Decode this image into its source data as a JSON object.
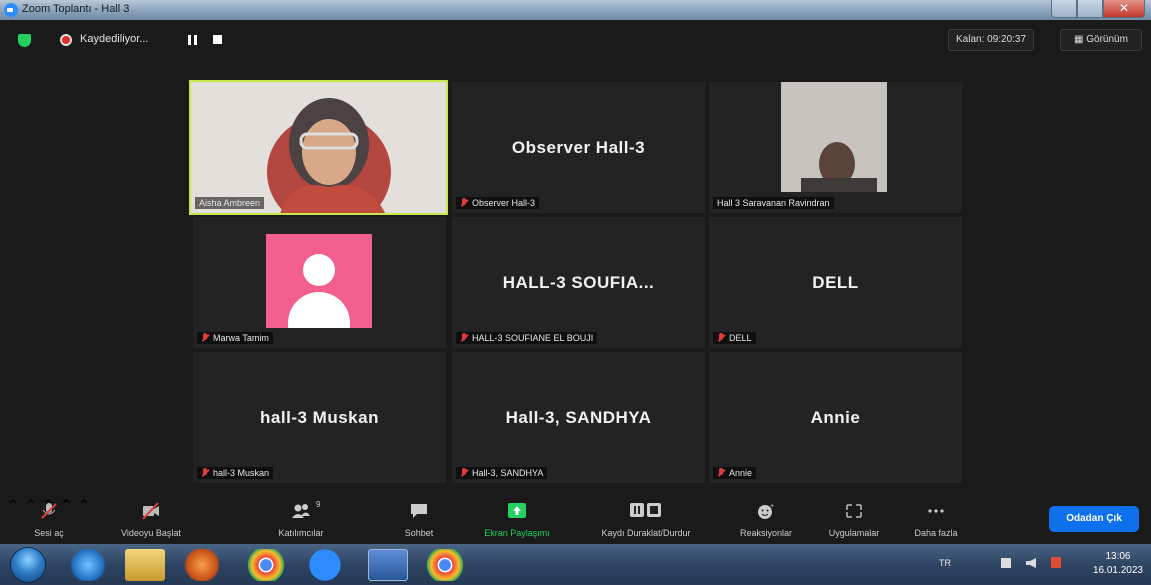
{
  "window": {
    "title": "Zoom Toplantı - Hall 3"
  },
  "topbar": {
    "recording_text": "Kaydediliyor...",
    "timer": "Kalan: 09:20:37",
    "view_label": "Görünüm"
  },
  "tiles": [
    {
      "display_name": "",
      "label": "Aisha Ambreen",
      "muted": false,
      "active": true
    },
    {
      "display_name": "Observer Hall-3",
      "label": "Observer Hall-3",
      "muted": true
    },
    {
      "display_name": "",
      "label": "Hall 3 Saravanan Ravindran",
      "muted": false
    },
    {
      "display_name": "",
      "label": "Marwa Tamim",
      "muted": true
    },
    {
      "display_name": "HALL-3  SOUFIA...",
      "label": "HALL-3 SOUFIANE EL BOUJI",
      "muted": true
    },
    {
      "display_name": "DELL",
      "label": "DELL",
      "muted": true
    },
    {
      "display_name": "hall-3 Muskan",
      "label": "hall-3 Muskan",
      "muted": true
    },
    {
      "display_name": "Hall-3, SANDHYA",
      "label": "Hall-3, SANDHYA",
      "muted": true
    },
    {
      "display_name": "Annie",
      "label": "Annie",
      "muted": true
    }
  ],
  "toolbar": {
    "audio": "Sesi aç",
    "video": "Videoyu Başlat",
    "participants": "Katılımcılar",
    "participants_count": "9",
    "chat": "Sohbet",
    "share": "Ekran Paylaşımı",
    "record": "Kaydı Duraklat/Durdur",
    "reactions": "Reaksiyonlar",
    "apps": "Uygulamalar",
    "more": "Daha fazla",
    "leave": "Odadan Çık"
  },
  "taskbar": {
    "lang": "TR",
    "time": "13:06",
    "date": "16.01.2023"
  },
  "colors": {
    "active_speaker": "#c5e84e",
    "share_green": "#23d160",
    "leave_blue": "#0e71eb",
    "avatar_pink": "#f25f8c"
  }
}
